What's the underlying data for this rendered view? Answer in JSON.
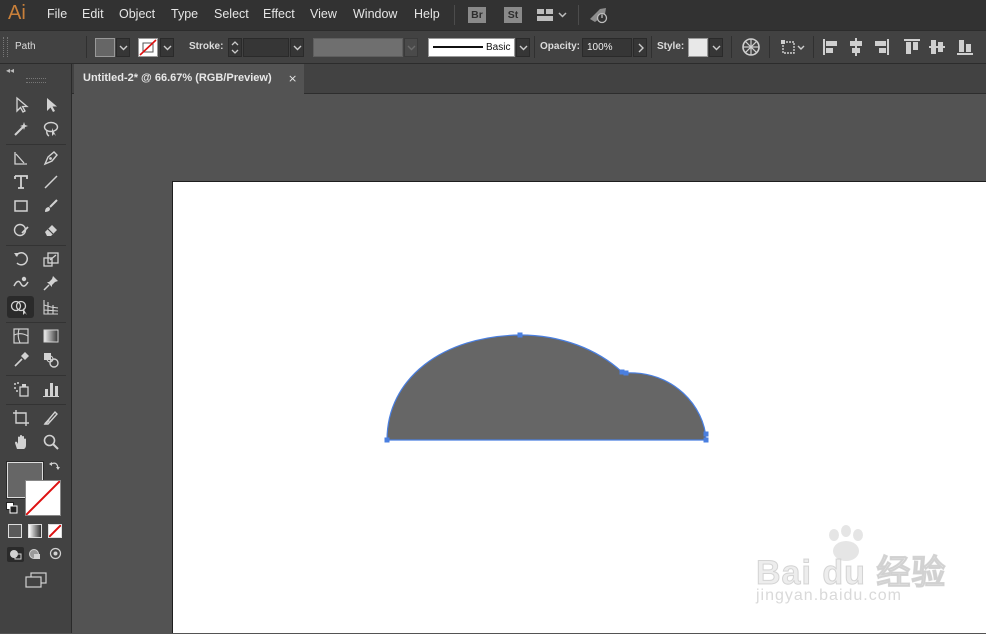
{
  "app": {
    "logo": "Ai"
  },
  "menu": {
    "items": [
      "File",
      "Edit",
      "Object",
      "Type",
      "Select",
      "Effect",
      "View",
      "Window",
      "Help"
    ]
  },
  "menu_badges": {
    "bridge": "Br",
    "stock": "St"
  },
  "control_bar": {
    "selection_type": "Path",
    "stroke_label": "Stroke:",
    "stroke_weight": "",
    "brush_name": "Basic",
    "opacity_label": "Opacity:",
    "opacity_value": "100%",
    "style_label": "Style:"
  },
  "document": {
    "tab_title": "Untitled-2* @ 66.67% (RGB/Preview)",
    "close_symbol": "×"
  },
  "colors": {
    "fill": "#666666",
    "selection_accent": "#4a7fe0",
    "app_logo": "#c9803a",
    "artboard": "#ffffff"
  },
  "watermark": {
    "brand": "Bai du 经验",
    "url": "jingyan.baidu.com"
  }
}
